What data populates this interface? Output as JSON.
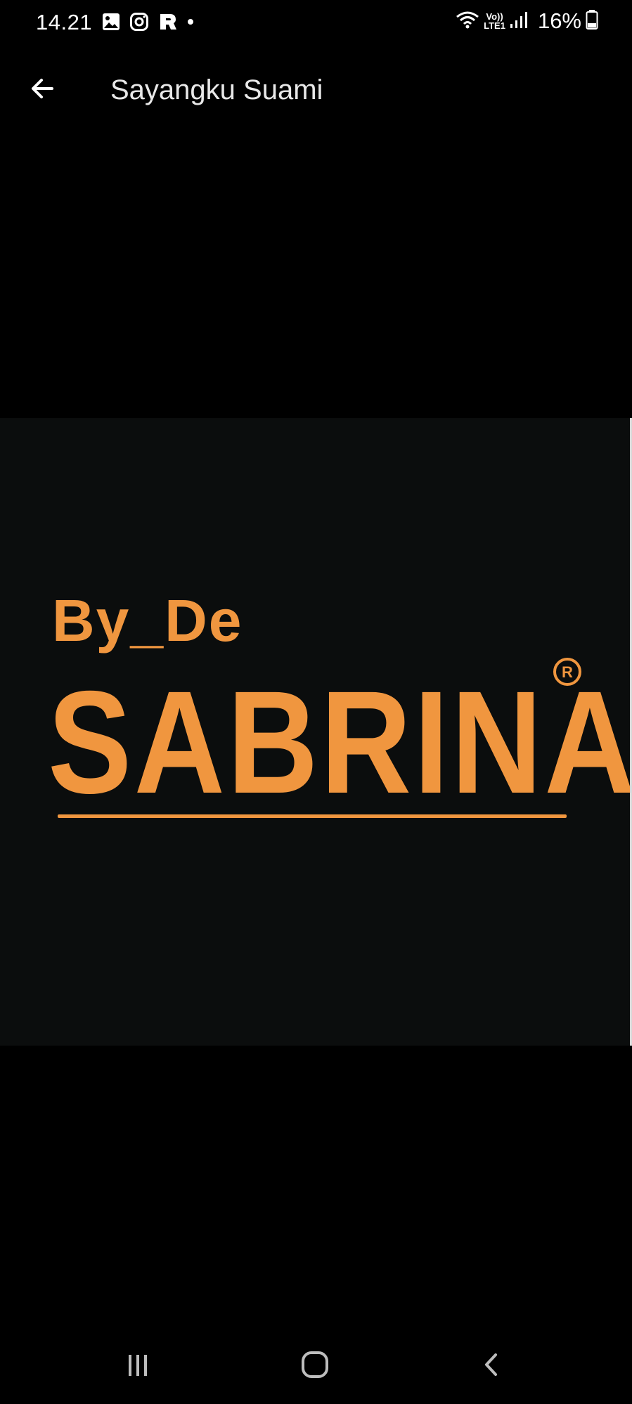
{
  "status_bar": {
    "time": "14.21",
    "battery_percent": "16%",
    "network_label": "LTE1",
    "volte_label": "Vo))",
    "left_icons": [
      "image-icon",
      "instagram-icon",
      "app-notification-icon",
      "dot-icon"
    ],
    "right_icons": [
      "wifi-icon",
      "volte-lte-icon",
      "signal-icon",
      "battery-icon"
    ]
  },
  "app_bar": {
    "title": "Sayangku Suami",
    "back_icon": "arrow-left-icon"
  },
  "image": {
    "logo_small_text": "By_De",
    "logo_main_text": "SABRINA",
    "registered_mark": "R",
    "background_color": "#0b0d0d",
    "accent_color": "#f0963f"
  },
  "nav_bar": {
    "items": [
      "recents-icon",
      "home-icon",
      "back-icon"
    ]
  }
}
